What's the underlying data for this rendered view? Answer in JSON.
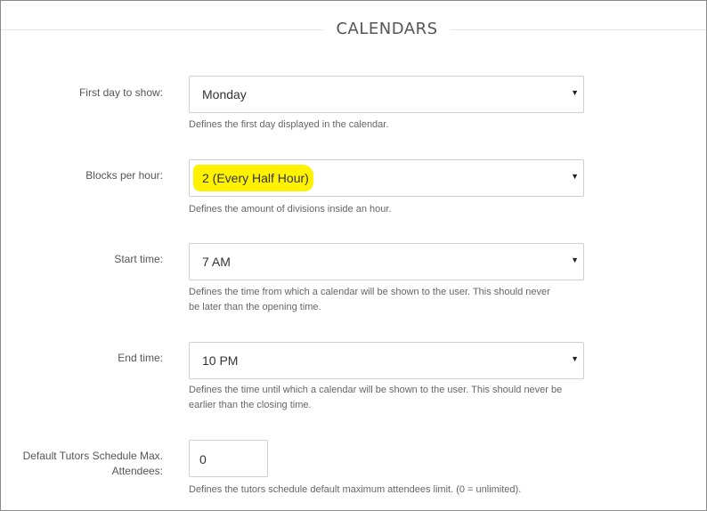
{
  "section": {
    "title": "CALENDARS"
  },
  "fields": {
    "first_day": {
      "label": "First day to show:",
      "value": "Monday",
      "help": "Defines the first day displayed in the calendar."
    },
    "blocks_per_hour": {
      "label": "Blocks per hour:",
      "value": "2 (Every Half Hour)",
      "help": "Defines the amount of divisions inside an hour.",
      "highlight_color": "#fff200"
    },
    "start_time": {
      "label": "Start time:",
      "value": "7 AM",
      "help_line1": "Defines the time from which a calendar will be shown to the user. This should never",
      "help_line2": "be later than the opening time."
    },
    "end_time": {
      "label": "End time:",
      "value": "10 PM",
      "help_line1": "Defines the time until which a calendar will be shown to the user. This should never be",
      "help_line2": "earlier than the closing time."
    },
    "max_attendees": {
      "label_line1": "Default Tutors Schedule Max.",
      "label_line2": "Attendees:",
      "value": "0",
      "help": "Defines the tutors schedule default maximum attendees limit. (0 = unlimited)."
    }
  },
  "icons": {
    "dropdown_caret": "caret-down-icon"
  }
}
